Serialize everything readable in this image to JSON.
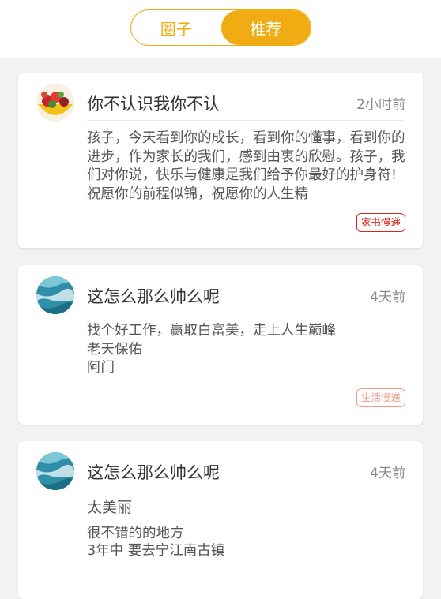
{
  "tabs": [
    {
      "label": "圈子",
      "active": false
    },
    {
      "label": "推荐",
      "active": true
    }
  ],
  "accent_color": "#f0ac12",
  "posts": [
    {
      "author": "你不认识我你不认",
      "time": "2小时前",
      "avatar_icon": "fruit-bowl-icon",
      "content_lines": [
        "孩子，今天看到你的成长，看到你的懂事，看到你的进步，作为家长的我们，感到由衷的欣慰。孩子，我们对你说，快乐与健康是我们给予你最好的护身符!祝愿你的前程似锦，祝愿你的人生精"
      ],
      "tag": "家书慢递",
      "tag_color": "#d8251a"
    },
    {
      "author": "这怎么那么帅么呢",
      "time": "4天前",
      "avatar_icon": "ocean-wave-icon",
      "content_lines": [
        "找个好工作，赢取白富美，走上人生巅峰",
        "老天保佑",
        "阿门"
      ],
      "tag": "生活慢递",
      "tag_color": "#f29a8c"
    },
    {
      "author": "这怎么那么帅么呢",
      "time": "4天前",
      "avatar_icon": "ocean-wave-icon",
      "content_lines": [
        "太美丽",
        "很不错的的地方",
        "3年中 要去宁江南古镇"
      ]
    }
  ]
}
